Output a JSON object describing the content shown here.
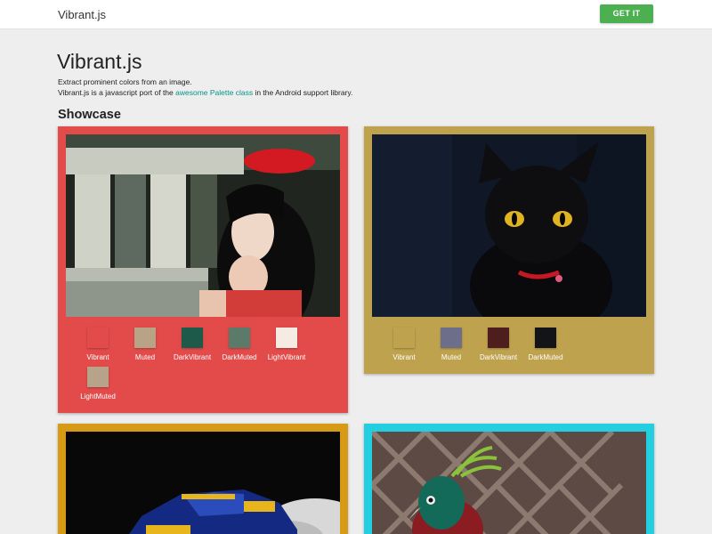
{
  "navbar": {
    "brand": "Vibrant.js",
    "cta_label": "GET IT",
    "cta_color": "#4caf50"
  },
  "header": {
    "title": "Vibrant.js",
    "line1": "Extract prominent colors from an image.",
    "line2_pre": "Vibrant.js is a javascript port of the ",
    "line2_link": "awesome Palette class",
    "line2_post": " in the Android support library.",
    "link_color": "#009688"
  },
  "showcase": {
    "title": "Showcase",
    "cards": [
      {
        "background": "#e34b4b",
        "image_icon": "girl-photo",
        "swatches": [
          {
            "label": "Vibrant",
            "color": "#e34b4b"
          },
          {
            "label": "Muted",
            "color": "#b9a386"
          },
          {
            "label": "DarkVibrant",
            "color": "#1d5a4a"
          },
          {
            "label": "DarkMuted",
            "color": "#5c7a6a"
          },
          {
            "label": "LightVibrant",
            "color": "#f6ebe3"
          },
          {
            "label": "LightMuted",
            "color": "#b7a38a"
          }
        ]
      },
      {
        "background": "#bfa24e",
        "image_icon": "black-cat-photo",
        "swatches": [
          {
            "label": "Vibrant",
            "color": "#bfa24e"
          },
          {
            "label": "Muted",
            "color": "#6c6e8a"
          },
          {
            "label": "DarkVibrant",
            "color": "#4e1d1d"
          },
          {
            "label": "DarkMuted",
            "color": "#121418"
          }
        ]
      },
      {
        "background": "#d69a14",
        "image_icon": "rally-car-photo",
        "swatches": []
      },
      {
        "background": "#21cfe0",
        "image_icon": "bird-photo",
        "swatches": []
      }
    ]
  }
}
